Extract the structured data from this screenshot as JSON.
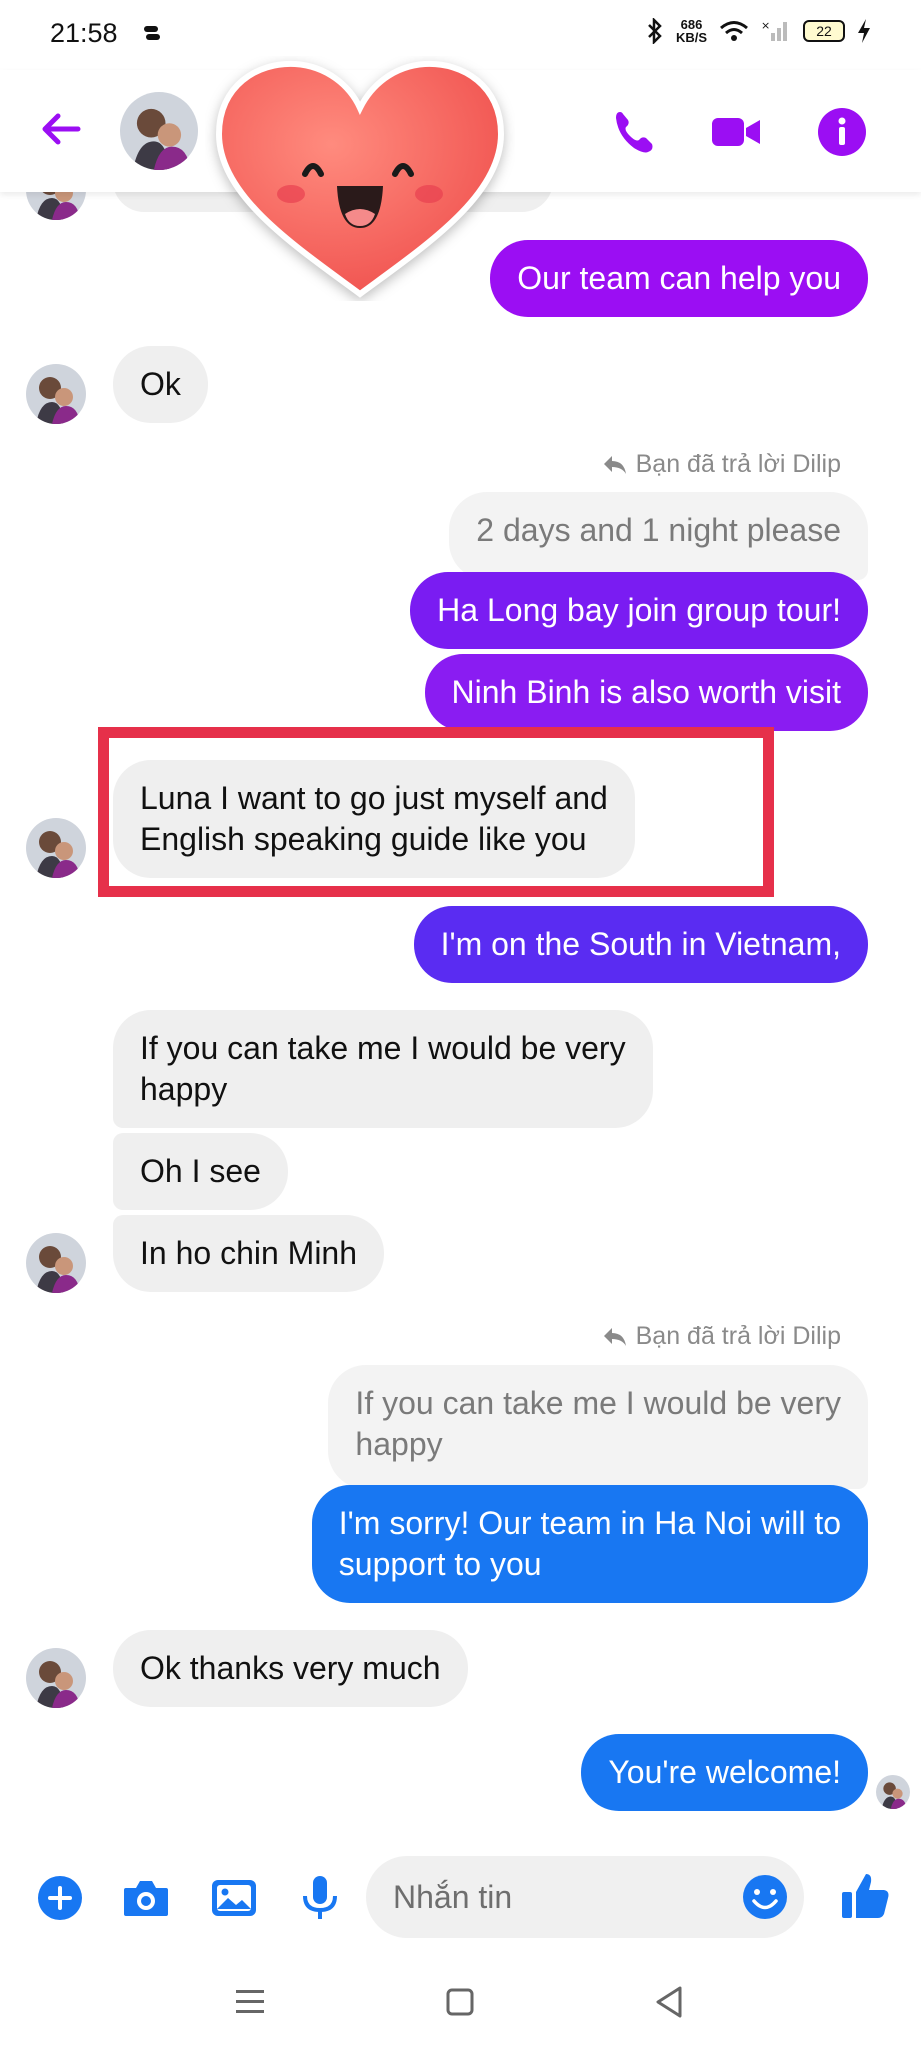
{
  "status_bar": {
    "time": "21:58",
    "net_speed": "686",
    "net_unit": "KB/S",
    "battery": "22"
  },
  "header": {
    "contact_avatar": "avatar",
    "icons": [
      "back-arrow-icon",
      "phone-icon",
      "video-camera-icon",
      "info-icon"
    ]
  },
  "colors": {
    "accent": "#9b0ef3",
    "blue": "#1877f2",
    "highlight": "#e6304a"
  },
  "messages": [
    {
      "side": "out",
      "text": "Our team can help you"
    },
    {
      "side": "in",
      "text": "Ok"
    },
    {
      "side": "note",
      "text": "Bạn đã trả lời Dilip"
    },
    {
      "side": "quote",
      "text": "2 days and 1 night please"
    },
    {
      "side": "out",
      "text": "Ha Long bay join group tour!"
    },
    {
      "side": "out",
      "text": "Ninh Binh is also worth visit"
    },
    {
      "side": "in",
      "lines": [
        "Luna I want to go just myself and",
        "English speaking guide like you"
      ]
    },
    {
      "side": "out",
      "text": "I'm on the South in Vietnam,"
    },
    {
      "side": "in",
      "lines": [
        "If you can take me I would be very",
        "happy"
      ]
    },
    {
      "side": "in",
      "text": "Oh I see"
    },
    {
      "side": "in",
      "text": "In ho chin Minh"
    },
    {
      "side": "note",
      "text": "Bạn đã trả lời Dilip"
    },
    {
      "side": "quote",
      "lines": [
        "If you can take me I would be very",
        "happy"
      ]
    },
    {
      "side": "out",
      "lines": [
        "I'm sorry! Our team in Ha Noi will to",
        "support to you"
      ]
    },
    {
      "side": "in",
      "text": "Ok thanks very much"
    },
    {
      "side": "out",
      "text": "You're welcome!"
    }
  ],
  "composer": {
    "placeholder": "Nhắn tin",
    "icons": [
      "plus-icon",
      "camera-icon",
      "image-icon",
      "microphone-icon",
      "emoji-icon",
      "thumbs-up-icon"
    ]
  },
  "nav": {
    "icons": [
      "menu-icon",
      "home-square-icon",
      "back-triangle-icon"
    ]
  }
}
